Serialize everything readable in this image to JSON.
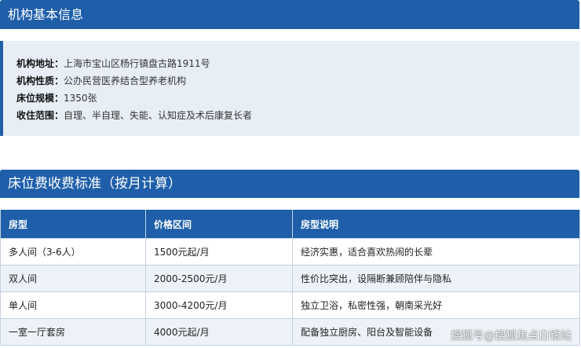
{
  "org_section": {
    "title": "机构基本信息",
    "rows": [
      {
        "label": "机构地址：",
        "value": "上海市宝山区杨行镇盘古路1911号"
      },
      {
        "label": "机构性质：",
        "value": "公办民营医养结合型养老机构"
      },
      {
        "label": "床位规模：",
        "value": "1350张"
      },
      {
        "label": "收住范围：",
        "value": "自理、半自理、失能、认知症及术后康复长者"
      }
    ]
  },
  "fee_section": {
    "title": "床位费收费标准（按月计算）",
    "headers": [
      "房型",
      "价格区间",
      "房型说明"
    ],
    "rows": [
      [
        "多人间（3-6人）",
        "1500元起/月",
        "经济实惠，适合喜欢热闹的长辈"
      ],
      [
        "双人间",
        "2000-2500元/月",
        "性价比突出，设隔断兼顾陪伴与隐私"
      ],
      [
        "单人间",
        "3000-4200元/月",
        "独立卫浴，私密性强，朝南采光好"
      ],
      [
        "一室一厅套房",
        "4000元起/月",
        "配备独立厨房、阳台及智能设备"
      ]
    ]
  },
  "watermark": "搜狐号@搜狐焦点白银站",
  "colors": {
    "header_blue": "#1f5faa",
    "info_bg": "#e8eef6",
    "row_alt_bg": "#edf2f8"
  }
}
